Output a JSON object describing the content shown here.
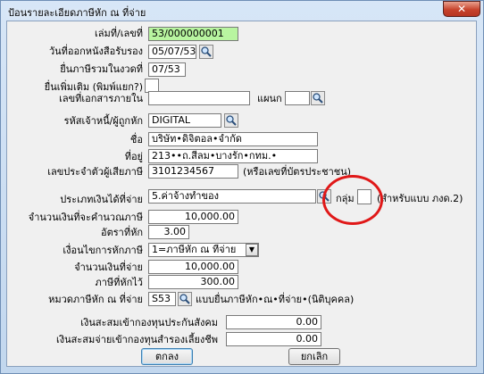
{
  "window": {
    "title": "ป้อนรายละเอียดภาษีหัก ณ ที่จ่าย",
    "close_glyph": "✕"
  },
  "fields": {
    "doc_no": {
      "label": "เล่มที่/เลขที่",
      "value": "53/000000001"
    },
    "cert_date": {
      "label": "วันที่ออกหนังสือรับรอง",
      "value": "05/07/53"
    },
    "filing_period": {
      "label": "ยื่นภาษีรวมในงวดที่",
      "value": "07/53"
    },
    "additional": {
      "label": "ยื่นเพิ่มเติม (พิมพ์แยก?)",
      "value": ""
    },
    "internal_doc": {
      "label": "เลขที่เอกสารภายใน",
      "value": ""
    },
    "department": {
      "label": "แผนก",
      "value": ""
    },
    "payee_code": {
      "label": "รหัสเจ้าหนี้/ผู้ถูกหัก",
      "value": "DIGITAL"
    },
    "name": {
      "label": "ชื่อ",
      "value": "บริษัท•ดิจิตอล•จำกัด"
    },
    "address": {
      "label": "ที่อยู่",
      "value": "213••ถ.สีลม•บางรัก•กทม.•"
    },
    "tax_id": {
      "label": "เลขประจำตัวผู้เสียภาษี",
      "value": "3101234567",
      "hint": "(หรือเลขที่บัตรประชาชน)"
    },
    "income_type": {
      "label": "ประเภทเงินได้ที่จ่าย",
      "value": "5.ค่าจ้างทำของ"
    },
    "group": {
      "label": "กลุ่ม",
      "value": "",
      "hint": "(สำหรับแบบ ภงด.2)"
    },
    "taxable_amount": {
      "label": "จำนวนเงินที่จะคำนวณภาษี",
      "value": "10,000.00"
    },
    "tax_rate": {
      "label": "อัตราที่หัก",
      "value": "3.00"
    },
    "withholding_cond": {
      "label": "เงื่อนไขการหักภาษี",
      "value": "1=ภาษีหัก ณ ที่จ่าย",
      "arrow": "▼"
    },
    "amount_paid": {
      "label": "จำนวนเงินที่จ่าย",
      "value": "10,000.00"
    },
    "tax_withheld": {
      "label": "ภาษีที่หักไว้",
      "value": "300.00"
    },
    "tax_category": {
      "label": "หมวดภาษีหัก ณ ที่จ่าย",
      "value": "S53",
      "hint": "แบบยื่นภาษีหัก•ณ•ที่จ่าย•(นิติบุคคล)"
    },
    "social_security": {
      "label": "เงินสะสมเข้ากองทุนประกันสังคม",
      "value": "0.00"
    },
    "provident_fund": {
      "label": "เงินสะสมจ่ายเข้ากองทุนสำรองเลี้ยงชีพ",
      "value": "0.00"
    }
  },
  "buttons": {
    "ok": "ตกลง",
    "cancel": "ยกเลิก"
  },
  "colors": {
    "required_field": "#b8f5a0",
    "highlight_circle": "#e01818"
  },
  "icons": {
    "search": "search-icon"
  }
}
